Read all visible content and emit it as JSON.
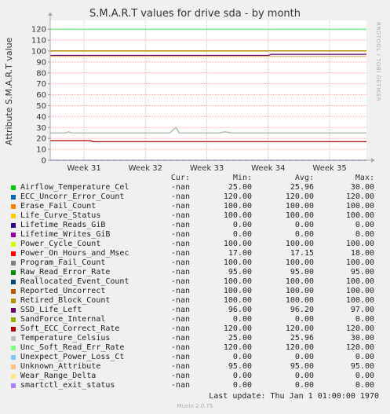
{
  "header": {
    "title": "S.M.A.R.T values for drive sda - by month",
    "ylabel": "Attribute S.M.A.R.T value",
    "watermark": "RRDTOOL / TOBI OETIKER"
  },
  "legend_header": {
    "cur": "Cur:",
    "min": "Min:",
    "avg": "Avg:",
    "max": "Max:"
  },
  "legend": [
    {
      "name": "Airflow_Temperature_Cel",
      "color": "#00CC00",
      "cur": "-nan",
      "min": "25.00",
      "avg": "25.96",
      "max": "30.00"
    },
    {
      "name": "ECC_Uncorr_Error_Count",
      "color": "#0066B3",
      "cur": "-nan",
      "min": "120.00",
      "avg": "120.00",
      "max": "120.00"
    },
    {
      "name": "Erase_Fail_Count",
      "color": "#FF8000",
      "cur": "-nan",
      "min": "100.00",
      "avg": "100.00",
      "max": "100.00"
    },
    {
      "name": "Life_Curve_Status",
      "color": "#FFCC00",
      "cur": "-nan",
      "min": "100.00",
      "avg": "100.00",
      "max": "100.00"
    },
    {
      "name": "Lifetime_Reads_GiB",
      "color": "#330099",
      "cur": "-nan",
      "min": "0.00",
      "avg": "0.00",
      "max": "0.00"
    },
    {
      "name": "Lifetime_Writes_GiB",
      "color": "#990099",
      "cur": "-nan",
      "min": "0.00",
      "avg": "0.00",
      "max": "0.00"
    },
    {
      "name": "Power_Cycle_Count",
      "color": "#CCFF00",
      "cur": "-nan",
      "min": "100.00",
      "avg": "100.00",
      "max": "100.00"
    },
    {
      "name": "Power_On_Hours_and_Msec",
      "color": "#FF0000",
      "cur": "-nan",
      "min": "17.00",
      "avg": "17.15",
      "max": "18.00"
    },
    {
      "name": "Program_Fail_Count",
      "color": "#808080",
      "cur": "-nan",
      "min": "100.00",
      "avg": "100.00",
      "max": "100.00"
    },
    {
      "name": "Raw_Read_Error_Rate",
      "color": "#008F00",
      "cur": "-nan",
      "min": "95.00",
      "avg": "95.00",
      "max": "95.00"
    },
    {
      "name": "Reallocated_Event_Count",
      "color": "#00487D",
      "cur": "-nan",
      "min": "100.00",
      "avg": "100.00",
      "max": "100.00"
    },
    {
      "name": "Reported_Uncorrect",
      "color": "#B35A00",
      "cur": "-nan",
      "min": "100.00",
      "avg": "100.00",
      "max": "100.00"
    },
    {
      "name": "Retired_Block_Count",
      "color": "#B38F00",
      "cur": "-nan",
      "min": "100.00",
      "avg": "100.00",
      "max": "100.00"
    },
    {
      "name": "SSD_Life_Left",
      "color": "#6B006B",
      "cur": "-nan",
      "min": "96.00",
      "avg": "96.20",
      "max": "97.00"
    },
    {
      "name": "SandForce_Internal",
      "color": "#8FB300",
      "cur": "-nan",
      "min": "0.00",
      "avg": "0.00",
      "max": "0.00"
    },
    {
      "name": "Soft_ECC_Correct_Rate",
      "color": "#B30000",
      "cur": "-nan",
      "min": "120.00",
      "avg": "120.00",
      "max": "120.00"
    },
    {
      "name": "Temperature_Celsius",
      "color": "#BEBEBE",
      "cur": "-nan",
      "min": "25.00",
      "avg": "25.96",
      "max": "30.00"
    },
    {
      "name": "Unc_Soft_Read_Err_Rate",
      "color": "#80FF80",
      "cur": "-nan",
      "min": "120.00",
      "avg": "120.00",
      "max": "120.00"
    },
    {
      "name": "Unexpect_Power_Loss_Ct",
      "color": "#80C9FF",
      "cur": "-nan",
      "min": "0.00",
      "avg": "0.00",
      "max": "0.00"
    },
    {
      "name": "Unknown_Attribute",
      "color": "#FFC080",
      "cur": "-nan",
      "min": "95.00",
      "avg": "95.00",
      "max": "95.00"
    },
    {
      "name": "Wear_Range_Delta",
      "color": "#FFE680",
      "cur": "-nan",
      "min": "0.00",
      "avg": "0.00",
      "max": "0.00"
    },
    {
      "name": "smartctl_exit_status",
      "color": "#AA80FF",
      "cur": "-nan",
      "min": "0.00",
      "avg": "0.00",
      "max": "0.00"
    }
  ],
  "last_update": "Last update: Thu Jan  1 01:00:00 1970",
  "footer": "Munin 2.0.75",
  "chart_data": {
    "type": "line",
    "title": "S.M.A.R.T values for drive sda - by month",
    "ylabel": "Attribute S.M.A.R.T value",
    "ylim": [
      0,
      128
    ],
    "yticks": [
      0,
      10,
      20,
      30,
      40,
      50,
      60,
      70,
      80,
      90,
      100,
      110,
      120
    ],
    "xlim": [
      30.45,
      35.6
    ],
    "xticks": [
      {
        "value": 31,
        "label": "Week 31"
      },
      {
        "value": 32,
        "label": "Week 32"
      },
      {
        "value": 33,
        "label": "Week 33"
      },
      {
        "value": 34,
        "label": "Week 34"
      },
      {
        "value": 35,
        "label": "Week 35"
      }
    ],
    "grid": true,
    "series": [
      {
        "name": "ECC_Uncorr_Error_Count",
        "color": "#0066B3",
        "x": [
          30.45,
          35.6
        ],
        "y": [
          120,
          120
        ]
      },
      {
        "name": "Unc_Soft_Read_Err_Rate",
        "color": "#80FF80",
        "x": [
          30.45,
          35.6
        ],
        "y": [
          120,
          120
        ]
      },
      {
        "name": "Erase_Fail_Count",
        "color": "#FF8000",
        "x": [
          30.45,
          35.6
        ],
        "y": [
          100,
          100
        ]
      },
      {
        "name": "Life_Curve_Status",
        "color": "#FFCC00",
        "x": [
          30.45,
          35.6
        ],
        "y": [
          100,
          100
        ]
      },
      {
        "name": "Reported_Uncorrect",
        "color": "#B35A00",
        "x": [
          30.45,
          35.6
        ],
        "y": [
          100,
          100
        ]
      },
      {
        "name": "Retired_Block_Count",
        "color": "#B38F00",
        "x": [
          30.45,
          35.6
        ],
        "y": [
          100,
          100
        ]
      },
      {
        "name": "SSD_Life_Left",
        "color": "#6B006B",
        "x": [
          30.45,
          34.0,
          34.05,
          35.6
        ],
        "y": [
          96,
          96,
          97,
          97
        ]
      },
      {
        "name": "Raw_Read_Error_Rate",
        "color": "#008F00",
        "x": [
          30.45,
          35.6
        ],
        "y": [
          95,
          95
        ]
      },
      {
        "name": "Unknown_Attribute",
        "color": "#FFC080",
        "x": [
          30.45,
          35.6
        ],
        "y": [
          95,
          95
        ]
      },
      {
        "name": "Airflow_Temperature_Cel",
        "color": "#00CC00",
        "x": [
          30.45,
          30.7,
          30.75,
          30.8,
          31.0,
          32.4,
          32.45,
          32.5,
          32.55,
          33.2,
          33.3,
          33.4,
          33.5,
          35.6
        ],
        "y": [
          25,
          25,
          26,
          25,
          25,
          25,
          28,
          30,
          25,
          25,
          26,
          25,
          25,
          25
        ]
      },
      {
        "name": "Temperature_Celsius",
        "color": "#BEBEBE",
        "x": [
          30.45,
          30.7,
          30.75,
          30.8,
          31.0,
          32.4,
          32.45,
          32.5,
          32.55,
          33.2,
          33.3,
          33.4,
          33.5,
          35.6
        ],
        "y": [
          25,
          25,
          26,
          25,
          25,
          25,
          28,
          30,
          25,
          25,
          26,
          25,
          25,
          25
        ]
      },
      {
        "name": "Power_On_Hours_and_Msec",
        "color": "#B30000",
        "x": [
          30.45,
          31.1,
          31.15,
          35.6
        ],
        "y": [
          18,
          18,
          17,
          17
        ]
      },
      {
        "name": "smartctl_exit_status",
        "color": "#AA80FF",
        "x": [
          30.45,
          35.6
        ],
        "y": [
          0,
          0
        ]
      },
      {
        "name": "Lifetime_Reads_GiB",
        "color": "#330099",
        "x": [
          30.45,
          35.6
        ],
        "y": [
          0,
          0
        ]
      }
    ]
  }
}
